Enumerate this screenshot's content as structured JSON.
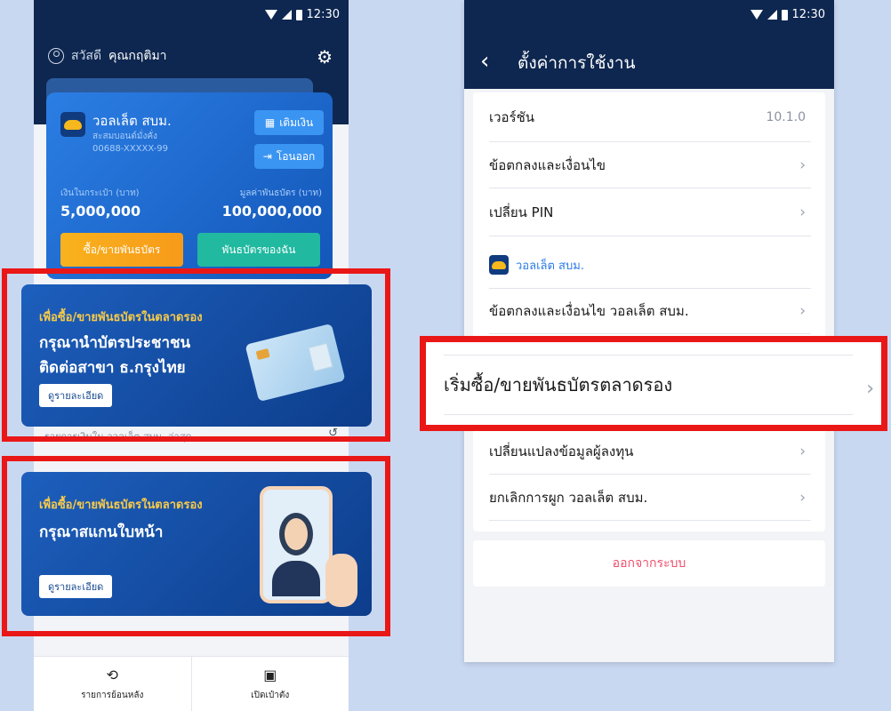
{
  "status": {
    "time": "12:30"
  },
  "left": {
    "greeting_prefix": "สวัสดี",
    "greeting_name": "คุณกฤติมา",
    "wallet": {
      "name": "วอลเล็ต สบม.",
      "sub1": "สะสมบอนด์มั่งคั่ง",
      "account": "00688-XXXXX-99",
      "topup_label": "เติมเงิน",
      "withdraw_label": "โอนออก",
      "balance_label": "เงินในกระเป๋า (บาท)",
      "balance_value": "5,000,000",
      "bond_label": "มูลค่าพันธบัตร (บาท)",
      "bond_value": "100,000,000",
      "buy_sell_label": "ซื้อ/ขายพันธบัตร",
      "my_bonds_label": "พันธบัตรของฉัน"
    },
    "promo1": {
      "kicker": "เพื่อซื้อ/ขายพันธบัตรในตลาดรอง",
      "line1": "กรุณานำบัตรประชาชน",
      "line2": "ติดต่อสาขา ธ.กรุงไทย",
      "detail": "ดูรายละเอียด"
    },
    "below_text": "รายการเงินใน วอลเล็ต สบม. ล่าสุด",
    "promo2": {
      "kicker": "เพื่อซื้อ/ขายพันธบัตรในตลาดรอง",
      "line1": "กรุณาสแกนใบหน้า",
      "detail": "ดูรายละเอียด"
    },
    "nav": [
      {
        "label": "รายการย้อนหลัง"
      },
      {
        "label": "เปิดเป๋าตัง"
      }
    ]
  },
  "right": {
    "title": "ตั้งค่าการใช้งาน",
    "version_label": "เวอร์ชัน",
    "version_value": "10.1.0",
    "terms": "ข้อตกลงและเงื่อนไข",
    "change_pin": "เปลี่ยน PIN",
    "section": "วอลเล็ต สบม.",
    "wallet_terms": "ข้อตกลงและเงื่อนไข วอลเล็ต สบม.",
    "start_trade": "เริ่มซื้อ/ขายพันธบัตรตลาดรอง",
    "change_info": "เปลี่ยนแปลงข้อมูลผู้ลงทุน",
    "unlink": "ยกเลิกการผูก วอลเล็ต สบม.",
    "logout": "ออกจากระบบ"
  }
}
